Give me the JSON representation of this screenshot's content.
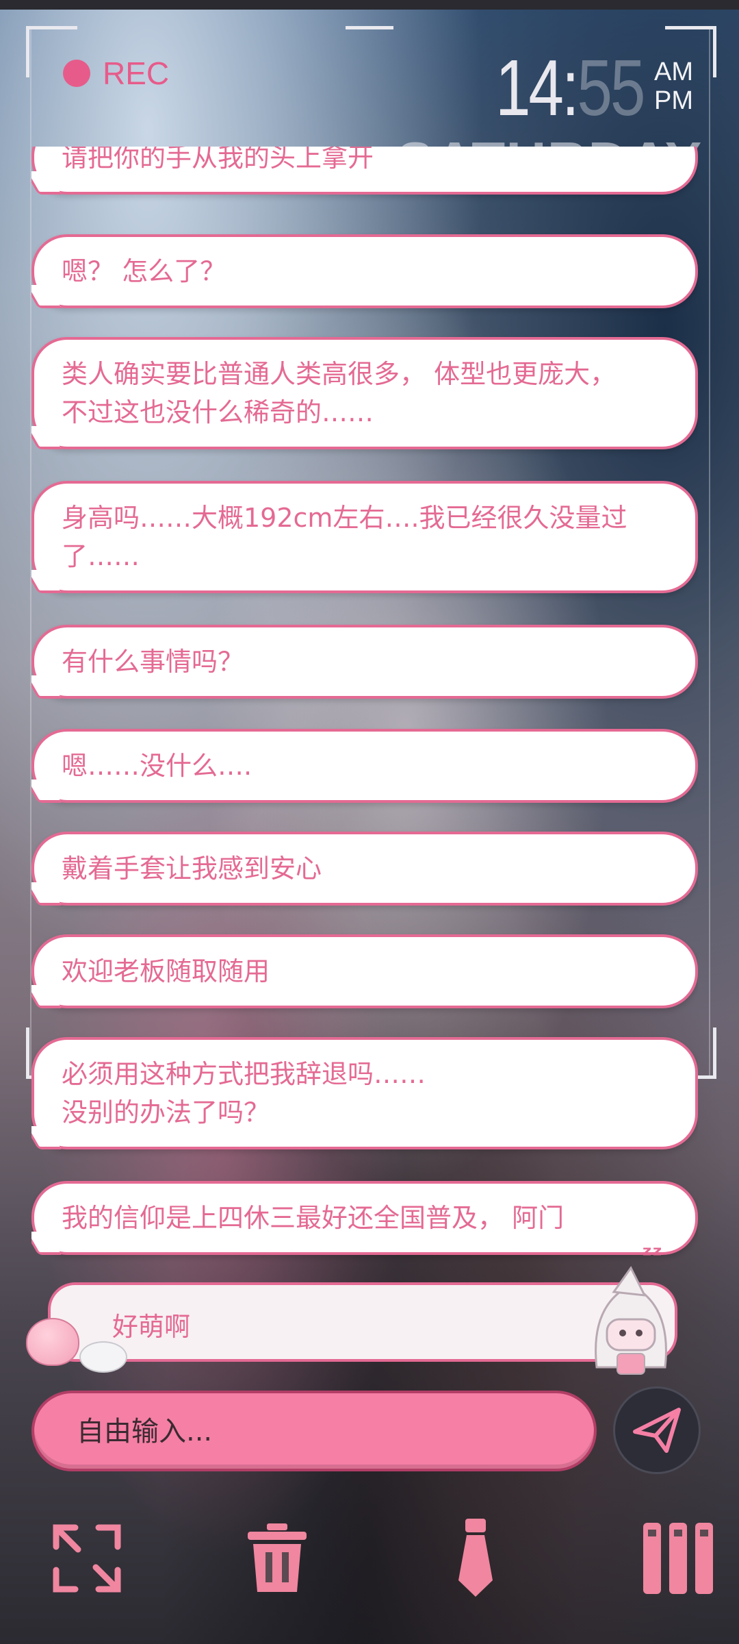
{
  "recorder": {
    "label": "REC",
    "time_hour": "14",
    "time_minute": "55",
    "am": "AM",
    "pm": "PM",
    "day": "SATURDAY"
  },
  "messages": [
    "请把你的手从我的头上拿开",
    "嗯？ 怎么了？",
    "类人确实要比普通人类高很多， 体型也更庞大，\n不过这也没什么稀奇的……",
    "身高吗……大概192cm左右….我已经很久没量过了……",
    "有什么事情吗？",
    "嗯……没什么….",
    "戴着手套让我感到安心",
    "欢迎老板随取随用",
    "必须用这种方式把我辞退吗……\n没别的办法了吗？",
    "我的信仰是上四休三最好还全国普及， 阿门"
  ],
  "suggestion": {
    "text": "好萌啊"
  },
  "composer": {
    "placeholder": "自由输入..."
  },
  "colors": {
    "accent": "#e46a93",
    "input_bg": "#f57fa5",
    "send_bg": "#2c2d36"
  },
  "toolbar": {
    "icons": [
      "expand-icon",
      "trash-icon",
      "tie-icon",
      "menu-bars-icon"
    ]
  }
}
